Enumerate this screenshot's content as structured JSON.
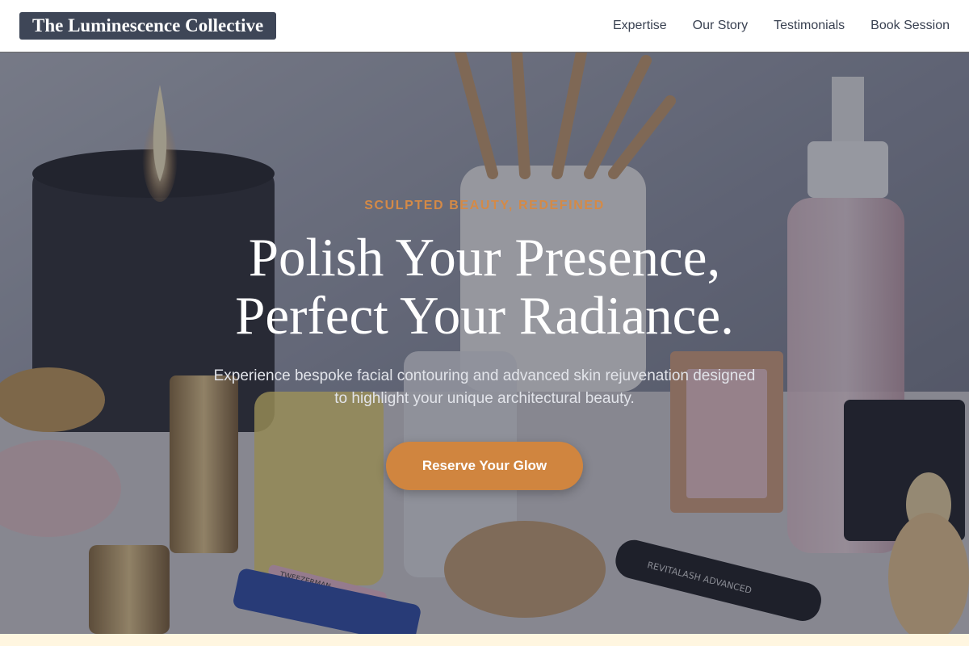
{
  "header": {
    "brand": "The Luminescence Collective",
    "nav": [
      {
        "label": "Expertise"
      },
      {
        "label": "Our Story"
      },
      {
        "label": "Testimonials"
      },
      {
        "label": "Book Session"
      }
    ]
  },
  "hero": {
    "kicker": "SCULPTED BEAUTY, REDEFINED",
    "title_line1": "Polish Your Presence,",
    "title_line2": "Perfect Your Radiance.",
    "subtitle": "Experience bespoke facial contouring and advanced skin rejuvenation designed to highlight your unique architectural beauty.",
    "cta_label": "Reserve Your Glow",
    "background_image": "cosmetics-vanity-photo",
    "background_labels": {
      "lash_tube": "REVITALASH ADVANCED",
      "tweezers": "TWEEZERMAN"
    }
  },
  "colors": {
    "brand_bg": "#3e4657",
    "accent": "#d0853f",
    "kicker": "#d48a47",
    "nav_text": "#3a4252",
    "footer_strip": "#fff6e0"
  }
}
